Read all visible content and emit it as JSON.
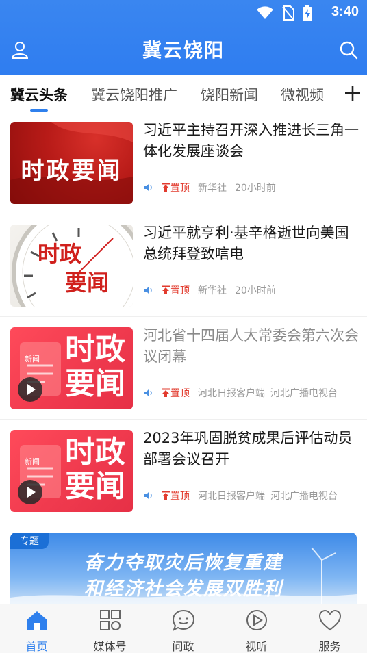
{
  "status_bar": {
    "time": "3:40"
  },
  "header": {
    "title": "冀云饶阳"
  },
  "tabs": [
    {
      "label": "冀云头条",
      "active": true
    },
    {
      "label": "冀云饶阳推广"
    },
    {
      "label": "饶阳新闻"
    },
    {
      "label": "微视频"
    }
  ],
  "news": [
    {
      "title": "习近平主持召开深入推进长三角一体化发展座谈会",
      "thumb_text": "时政要闻",
      "pin_label": "置顶",
      "source": "新华社",
      "time": "20小时前"
    },
    {
      "title": "习近平就亨利·基辛格逝世向美国总统拜登致唁电",
      "thumb_text_1": "时政",
      "thumb_text_2": "要闻",
      "pin_label": "置顶",
      "source": "新华社",
      "time": "20小时前"
    },
    {
      "title": "河北省十四届人大常委会第六次会议闭幕",
      "thumb_text_1": "时政",
      "thumb_text_2": "要闻",
      "thumb_small": "新闻",
      "pin_label": "置顶",
      "source": "河北日报客户端",
      "time": "河北广播电视台"
    },
    {
      "title": "2023年巩固脱贫成果后评估动员部署会议召开",
      "thumb_text_1": "时政",
      "thumb_text_2": "要闻",
      "thumb_small": "新闻",
      "pin_label": "置顶",
      "source": "河北日报客户端",
      "time": "河北广播电视台"
    }
  ],
  "banner": {
    "tag": "专题",
    "line1": "奋力夺取灾后恢复重建",
    "line2": "和经济社会发展双胜利"
  },
  "bottom_nav": [
    {
      "label": "首页",
      "icon": "home-icon",
      "active": true
    },
    {
      "label": "媒体号",
      "icon": "grid-icon"
    },
    {
      "label": "问政",
      "icon": "chat-icon"
    },
    {
      "label": "视听",
      "icon": "play-icon"
    },
    {
      "label": "服务",
      "icon": "heart-icon"
    }
  ],
  "colors": {
    "brand": "#2f7df0",
    "pin": "#e23b2e",
    "active_tab": "#2f80ed"
  }
}
